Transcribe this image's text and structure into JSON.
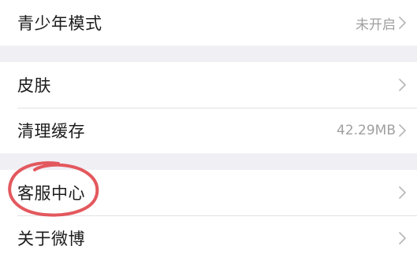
{
  "settings": {
    "groups": [
      {
        "items": [
          {
            "label": "青少年模式",
            "value": "未开启"
          }
        ]
      },
      {
        "items": [
          {
            "label": "皮肤",
            "value": ""
          },
          {
            "label": "清理缓存",
            "value": "42.29MB"
          }
        ]
      },
      {
        "items": [
          {
            "label": "客服中心",
            "value": ""
          },
          {
            "label": "关于微博",
            "value": ""
          }
        ]
      }
    ]
  },
  "colors": {
    "background": "#efeff4",
    "row_background": "#ffffff",
    "label_text": "#1c1c1c",
    "value_text": "#a0a0a0",
    "chevron": "#b5b5b5",
    "annotation_circle": "#e0474c"
  },
  "icons": {
    "row_arrow": "chevron-right-icon",
    "annotation": "hand-drawn-circle"
  }
}
